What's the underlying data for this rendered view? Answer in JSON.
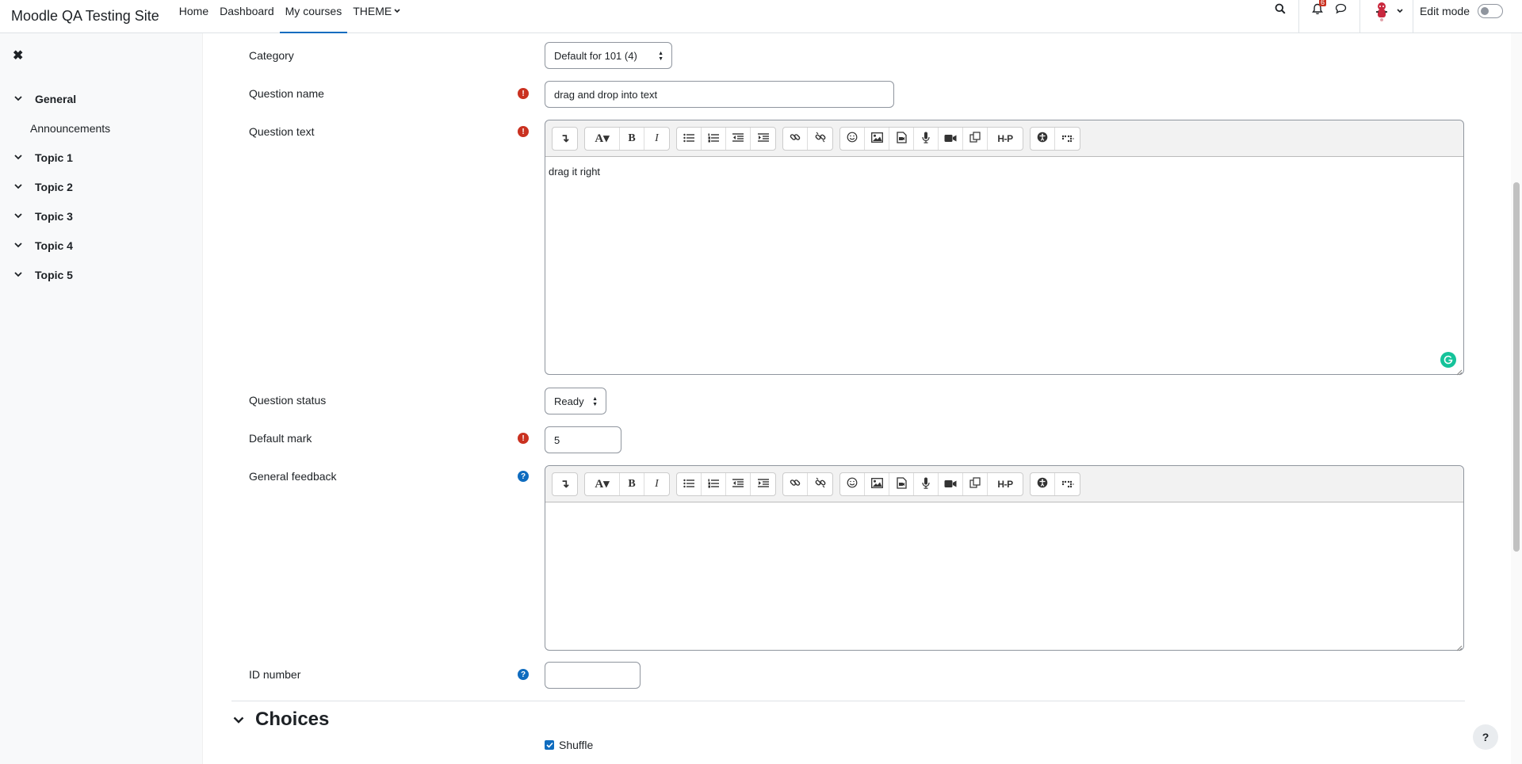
{
  "site": {
    "title": "Moodle QA Testing Site"
  },
  "nav": {
    "items": [
      {
        "label": "Home"
      },
      {
        "label": "Dashboard"
      },
      {
        "label": "My courses"
      },
      {
        "label": "THEME"
      }
    ],
    "active": "My courses",
    "notification_count": "6",
    "edit_mode_label": "Edit mode"
  },
  "course_index": {
    "sections": [
      {
        "label": "General",
        "activities": [
          "Announcements"
        ]
      },
      {
        "label": "Topic 1"
      },
      {
        "label": "Topic 2"
      },
      {
        "label": "Topic 3"
      },
      {
        "label": "Topic 4"
      },
      {
        "label": "Topic 5"
      }
    ]
  },
  "form": {
    "category": {
      "label": "Category",
      "value": "Default for 101 (4)"
    },
    "question_name": {
      "label": "Question name",
      "value": "drag and drop into text"
    },
    "question_text": {
      "label": "Question text",
      "value": "drag it right"
    },
    "question_status": {
      "label": "Question status",
      "value": "Ready"
    },
    "default_mark": {
      "label": "Default mark",
      "value": "5"
    },
    "general_feedback": {
      "label": "General feedback",
      "value": ""
    },
    "id_number": {
      "label": "ID number",
      "value": ""
    }
  },
  "choices": {
    "title": "Choices",
    "shuffle_label": "Shuffle",
    "shuffle_checked": true
  },
  "colors": {
    "accent": "#0f6cbf",
    "required": "#ca3120",
    "grammarly": "#15c39a"
  }
}
